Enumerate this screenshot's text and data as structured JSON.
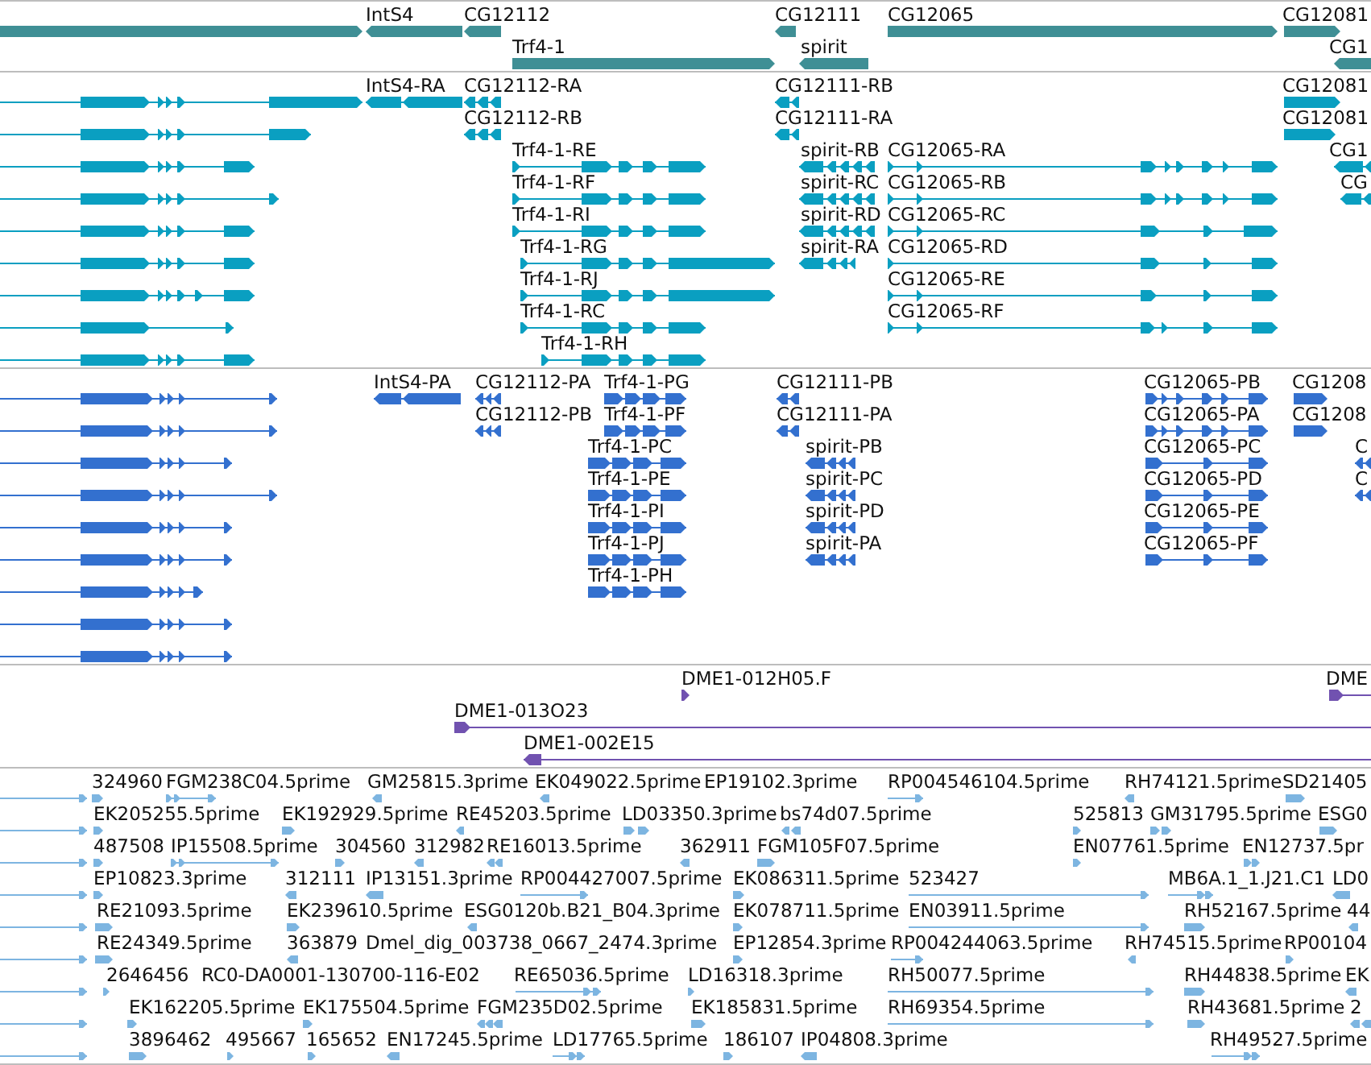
{
  "tracks": [
    {
      "kind": "gene",
      "rows": [
        {
          "features": [
            {
              "reverse": false
            },
            {
              "label": "IntS4",
              "reverse": true
            },
            {
              "label": "CG12112",
              "reverse": true
            },
            {
              "label": "CG12111",
              "reverse": true
            },
            {
              "label": "CG12065",
              "reverse": false
            },
            {
              "label": "CG12081",
              "reverse": false
            }
          ]
        },
        {
          "features": [
            {
              "label": "Trf4-1",
              "reverse": false
            },
            {
              "label": "spirit",
              "reverse": true
            },
            {
              "label": "CG1",
              "reverse": true
            }
          ]
        }
      ]
    },
    {
      "kind": "transcript",
      "rows": [
        {
          "features": [
            {
              "reverse": false
            },
            {
              "label": "IntS4-RA",
              "reverse": true
            },
            {
              "label": "CG12112-RA",
              "reverse": true
            },
            {
              "label": "CG12111-RB",
              "reverse": true
            },
            {
              "label": "CG12081",
              "reverse": false
            }
          ]
        },
        {
          "features": [
            {
              "reverse": false
            },
            {
              "label": "CG12112-RB",
              "reverse": true
            },
            {
              "label": "CG12111-RA",
              "reverse": true
            },
            {
              "label": "CG12081",
              "reverse": false
            }
          ]
        },
        {
          "features": [
            {
              "reverse": false
            },
            {
              "label": "Trf4-1-RE",
              "reverse": false
            },
            {
              "label": "spirit-RB",
              "reverse": true
            },
            {
              "label": "CG12065-RA",
              "reverse": false
            },
            {
              "label": "CG1",
              "reverse": true
            }
          ]
        },
        {
          "features": [
            {
              "reverse": false
            },
            {
              "label": "Trf4-1-RF",
              "reverse": false
            },
            {
              "label": "spirit-RC",
              "reverse": true
            },
            {
              "label": "CG12065-RB",
              "reverse": false
            },
            {
              "label": "CG",
              "reverse": true
            }
          ]
        },
        {
          "features": [
            {
              "reverse": false
            },
            {
              "label": "Trf4-1-RI",
              "reverse": false
            },
            {
              "label": "spirit-RD",
              "reverse": true
            },
            {
              "label": "CG12065-RC",
              "reverse": false
            }
          ]
        },
        {
          "features": [
            {
              "reverse": false
            },
            {
              "label": "Trf4-1-RG",
              "reverse": false
            },
            {
              "label": "spirit-RA",
              "reverse": true
            },
            {
              "label": "CG12065-RD",
              "reverse": false
            }
          ]
        },
        {
          "features": [
            {
              "reverse": false
            },
            {
              "label": "Trf4-1-RJ",
              "reverse": false
            },
            {
              "label": "CG12065-RE",
              "reverse": false
            }
          ]
        },
        {
          "features": [
            {
              "reverse": false
            },
            {
              "label": "Trf4-1-RC",
              "reverse": false
            },
            {
              "label": "CG12065-RF",
              "reverse": false
            }
          ]
        },
        {
          "features": [
            {
              "reverse": false
            },
            {
              "label": "Trf4-1-RH",
              "reverse": false
            }
          ]
        }
      ]
    },
    {
      "kind": "protein",
      "rows": [
        {
          "features": [
            {
              "reverse": false
            },
            {
              "label": "IntS4-PA",
              "reverse": true
            },
            {
              "label": "CG12112-PA",
              "reverse": true
            },
            {
              "label": "Trf4-1-PG",
              "reverse": false
            },
            {
              "label": "CG12111-PB",
              "reverse": true
            },
            {
              "label": "CG12065-PB",
              "reverse": false
            },
            {
              "label": "CG1208",
              "reverse": false
            }
          ]
        },
        {
          "features": [
            {
              "reverse": false
            },
            {
              "label": "CG12112-PB",
              "reverse": true
            },
            {
              "label": "Trf4-1-PF",
              "reverse": false
            },
            {
              "label": "CG12111-PA",
              "reverse": true
            },
            {
              "label": "CG12065-PA",
              "reverse": false
            },
            {
              "label": "CG1208",
              "reverse": false
            }
          ]
        },
        {
          "features": [
            {
              "reverse": false
            },
            {
              "label": "Trf4-1-PC",
              "reverse": false
            },
            {
              "label": "spirit-PB",
              "reverse": true
            },
            {
              "label": "CG12065-PC",
              "reverse": false
            },
            {
              "label": "C",
              "reverse": true
            }
          ]
        },
        {
          "features": [
            {
              "reverse": false
            },
            {
              "label": "Trf4-1-PE",
              "reverse": false
            },
            {
              "label": "spirit-PC",
              "reverse": true
            },
            {
              "label": "CG12065-PD",
              "reverse": false
            },
            {
              "label": "C",
              "reverse": true
            }
          ]
        },
        {
          "features": [
            {
              "reverse": false
            },
            {
              "label": "Trf4-1-PI",
              "reverse": false
            },
            {
              "label": "spirit-PD",
              "reverse": true
            },
            {
              "label": "CG12065-PE",
              "reverse": false
            }
          ]
        },
        {
          "features": [
            {
              "reverse": false
            },
            {
              "label": "Trf4-1-PJ",
              "reverse": false
            },
            {
              "label": "spirit-PA",
              "reverse": true
            },
            {
              "label": "CG12065-PF",
              "reverse": false
            }
          ]
        },
        {
          "features": [
            {
              "reverse": false
            },
            {
              "label": "Trf4-1-PH",
              "reverse": false
            }
          ]
        },
        {
          "features": [
            {
              "reverse": false
            }
          ]
        },
        {
          "features": [
            {
              "reverse": false
            }
          ]
        }
      ]
    },
    {
      "kind": "clone",
      "rows": [
        {
          "features": [
            {
              "label": "DME1-012H05.F",
              "reverse": false
            },
            {
              "label": "DME",
              "reverse": false
            }
          ]
        },
        {
          "features": [
            {
              "label": "DME1-013O23",
              "reverse": false
            }
          ]
        },
        {
          "features": [
            {
              "label": "DME1-002E15",
              "reverse": true
            }
          ]
        }
      ]
    },
    {
      "kind": "est",
      "rows": [
        {
          "features": [
            {
              "reverse": false
            },
            {
              "label": "324960",
              "reverse": false
            },
            {
              "label": "FGM238C04.5prime",
              "reverse": false
            },
            {
              "label": "GM25815.3prime",
              "reverse": true
            },
            {
              "label": "EK049022.5prime",
              "reverse": true
            },
            {
              "label": "EP19102.3prime"
            },
            {
              "label": "RP004546104.5prime",
              "reverse": false
            },
            {
              "label": "RH74121.5prime",
              "reverse": true
            },
            {
              "label": "SD21405",
              "reverse": false
            }
          ]
        },
        {
          "features": [
            {
              "reverse": false
            },
            {
              "label": "EK205255.5prime",
              "reverse": false
            },
            {
              "label": "EK192929.5prime",
              "reverse": false
            },
            {
              "label": "RE45203.5prime",
              "reverse": true
            },
            {
              "label": "LD03350.3prime",
              "reverse": false
            },
            {
              "label": "bs74d07.5prime",
              "reverse": true
            },
            {
              "label": "525813",
              "reverse": false
            },
            {
              "label": "GM31795.5prime",
              "reverse": false
            },
            {
              "label": "ESG0",
              "reverse": false
            }
          ]
        },
        {
          "features": [
            {
              "reverse": false
            },
            {
              "label": "487508",
              "reverse": false
            },
            {
              "label": "IP15508.5prime",
              "reverse": false
            },
            {
              "label": "304560",
              "reverse": false
            },
            {
              "label": "312982",
              "reverse": true
            },
            {
              "label": "RE16013.5prime",
              "reverse": true
            },
            {
              "label": "362911",
              "reverse": true
            },
            {
              "label": "FGM105F07.5prime",
              "reverse": false
            },
            {
              "label": "EN07761.5prime",
              "reverse": false
            },
            {
              "label": "EN12737.5pr",
              "reverse": false
            }
          ]
        },
        {
          "features": [
            {
              "reverse": false
            },
            {
              "label": "EP10823.3prime",
              "reverse": false
            },
            {
              "label": "312111",
              "reverse": true
            },
            {
              "label": "IP13151.3prime",
              "reverse": true
            },
            {
              "label": "RP004427007.5prime",
              "reverse": false
            },
            {
              "label": "EK086311.5prime",
              "reverse": false
            },
            {
              "label": "523427",
              "reverse": false
            },
            {
              "label": "MB6A.1_1.J21.C1",
              "reverse": false
            },
            {
              "label": "LD0",
              "reverse": true
            }
          ]
        },
        {
          "features": [
            {
              "reverse": false
            },
            {
              "label": "RE21093.5prime",
              "reverse": false
            },
            {
              "label": "EK239610.5prime",
              "reverse": false
            },
            {
              "label": "ESG0120b.B21_B04.3prime",
              "reverse": true
            },
            {
              "label": "EK078711.5prime",
              "reverse": false
            },
            {
              "label": "EN03911.5prime",
              "reverse": false
            },
            {
              "label": "RH52167.5prime",
              "reverse": false
            },
            {
              "label": "44",
              "reverse": true
            }
          ]
        },
        {
          "features": [
            {
              "reverse": false
            },
            {
              "label": "RE24349.5prime",
              "reverse": false
            },
            {
              "label": "363879",
              "reverse": true
            },
            {
              "label": "Dmel_dig_003738_0667_2474.3prime"
            },
            {
              "label": "EP12854.3prime",
              "reverse": false
            },
            {
              "label": "RP004244063.5prime",
              "reverse": false
            },
            {
              "label": "RH74515.5prime",
              "reverse": true
            },
            {
              "label": "RP00104",
              "reverse": false
            }
          ]
        },
        {
          "features": [
            {
              "reverse": false
            },
            {
              "label": "2646456",
              "reverse": false
            },
            {
              "label": "RC0-DA0001-130700-116-E02"
            },
            {
              "label": "RE65036.5prime",
              "reverse": false
            },
            {
              "label": "LD16318.3prime",
              "reverse": false
            },
            {
              "label": "RH50077.5prime",
              "reverse": false
            },
            {
              "label": "RH44838.5prime",
              "reverse": false
            },
            {
              "label": "EK",
              "reverse": true
            }
          ]
        },
        {
          "features": [
            {
              "reverse": false
            },
            {
              "label": "EK162205.5prime",
              "reverse": false
            },
            {
              "label": "EK175504.5prime",
              "reverse": false
            },
            {
              "label": "FGM235D02.5prime",
              "reverse": true
            },
            {
              "label": "EK185831.5prime",
              "reverse": false
            },
            {
              "label": "RH69354.5prime",
              "reverse": false
            },
            {
              "label": "RH43681.5prime",
              "reverse": false
            },
            {
              "label": "2",
              "reverse": true
            }
          ]
        },
        {
          "features": [
            {
              "reverse": false
            },
            {
              "label": "3896462",
              "reverse": false
            },
            {
              "label": "495667",
              "reverse": false
            },
            {
              "label": "165652",
              "reverse": false
            },
            {
              "label": "EN17245.5prime",
              "reverse": true
            },
            {
              "label": "LD17765.5prime",
              "reverse": false
            },
            {
              "label": "186107",
              "reverse": false
            },
            {
              "label": "IP04808.3prime",
              "reverse": true
            },
            {
              "label": "RH49527.5prime",
              "reverse": false
            }
          ]
        }
      ]
    }
  ]
}
